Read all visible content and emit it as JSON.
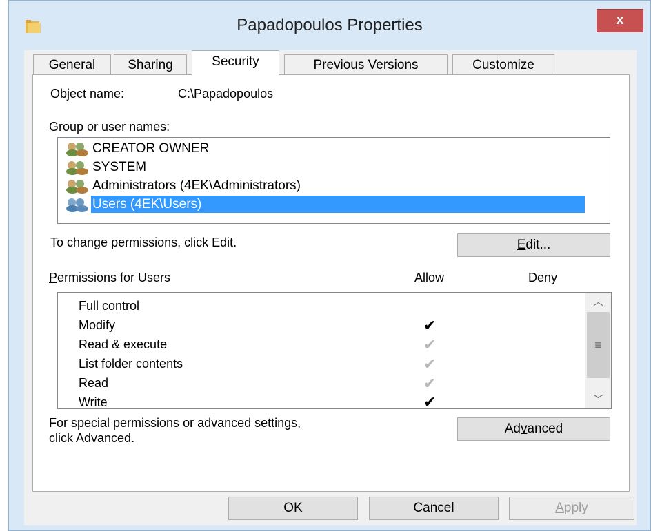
{
  "window": {
    "title": "Papadopoulos Properties",
    "close_glyph": "x"
  },
  "tabs": [
    {
      "label": "General"
    },
    {
      "label": "Sharing"
    },
    {
      "label": "Security"
    },
    {
      "label": "Previous Versions"
    },
    {
      "label": "Customize"
    }
  ],
  "security": {
    "object_name_label": "Object name:",
    "object_name_value": "C:\\Papadopoulos",
    "group_label_accel": "G",
    "group_label_rest": "roup or user names:",
    "groups": [
      {
        "name": "CREATOR OWNER",
        "icon": "user-group-icon"
      },
      {
        "name": "SYSTEM",
        "icon": "user-group-icon"
      },
      {
        "name": "Administrators (4EK\\Administrators)",
        "icon": "user-group-icon"
      },
      {
        "name": "Users (4EK\\Users)",
        "icon": "user-group-icon",
        "selected": true
      }
    ],
    "change_hint": "To change permissions, click Edit.",
    "edit_button_accel": "E",
    "edit_button_rest": "dit...",
    "perm_label_accel": "P",
    "perm_label_rest": "ermissions for Users",
    "allow_header": "Allow",
    "deny_header": "Deny",
    "permissions": [
      {
        "name": "Full control",
        "allow": "",
        "deny": ""
      },
      {
        "name": "Modify",
        "allow": "checked",
        "deny": ""
      },
      {
        "name": "Read & execute",
        "allow": "inherited",
        "deny": ""
      },
      {
        "name": "List folder contents",
        "allow": "inherited",
        "deny": ""
      },
      {
        "name": "Read",
        "allow": "inherited",
        "deny": ""
      },
      {
        "name": "Write",
        "allow": "checked",
        "deny": ""
      }
    ],
    "special_line1": "For special permissions or advanced settings,",
    "special_line2": "click Advanced.",
    "advanced_pre": "Ad",
    "advanced_accel": "v",
    "advanced_post": "anced"
  },
  "footer": {
    "ok_label": "OK",
    "cancel_label": "Cancel",
    "apply_accel": "A",
    "apply_rest": "pply"
  },
  "colors": {
    "selection": "#3399ff",
    "title_bg": "#d9e8f7",
    "close_bg": "#c75050"
  },
  "icons": {
    "check": "✔",
    "scroll_up": "︿",
    "scroll_down": "﹀",
    "grip": "≡"
  }
}
